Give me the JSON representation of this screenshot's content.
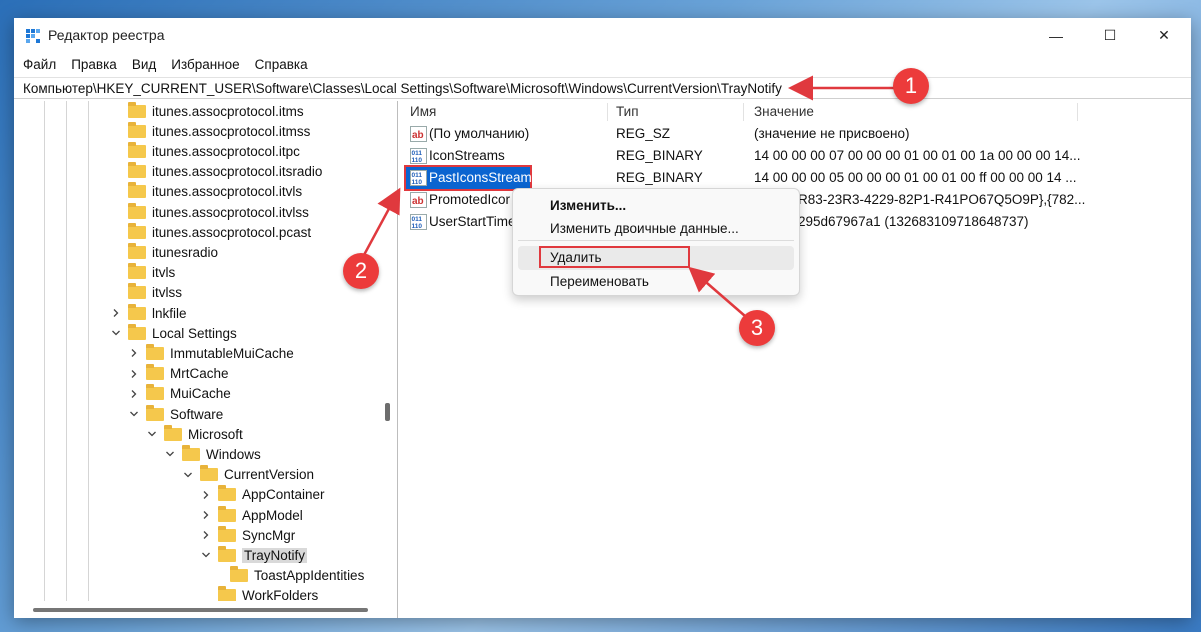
{
  "window": {
    "title": "Редактор реестра",
    "controls": {
      "minimize": "—",
      "maximize": "☐",
      "close": "✕"
    }
  },
  "menu": [
    "Файл",
    "Правка",
    "Вид",
    "Избранное",
    "Справка"
  ],
  "address": "Компьютер\\HKEY_CURRENT_USER\\Software\\Classes\\Local Settings\\Software\\Microsoft\\Windows\\CurrentVersion\\TrayNotify",
  "tree": [
    {
      "label": "itunes.assocprotocol.itms",
      "level": 0,
      "chevron": "none"
    },
    {
      "label": "itunes.assocprotocol.itmss",
      "level": 0,
      "chevron": "none"
    },
    {
      "label": "itunes.assocprotocol.itpc",
      "level": 0,
      "chevron": "none"
    },
    {
      "label": "itunes.assocprotocol.itsradio",
      "level": 0,
      "chevron": "none"
    },
    {
      "label": "itunes.assocprotocol.itvls",
      "level": 0,
      "chevron": "none"
    },
    {
      "label": "itunes.assocprotocol.itvlss",
      "level": 0,
      "chevron": "none"
    },
    {
      "label": "itunes.assocprotocol.pcast",
      "level": 0,
      "chevron": "none"
    },
    {
      "label": "itunesradio",
      "level": 0,
      "chevron": "none"
    },
    {
      "label": "itvls",
      "level": 0,
      "chevron": "none"
    },
    {
      "label": "itvlss",
      "level": 0,
      "chevron": "none"
    },
    {
      "label": "lnkfile",
      "level": 0,
      "chevron": "right"
    },
    {
      "label": "Local Settings",
      "level": 0,
      "chevron": "down"
    },
    {
      "label": "ImmutableMuiCache",
      "level": 1,
      "chevron": "right"
    },
    {
      "label": "MrtCache",
      "level": 1,
      "chevron": "right"
    },
    {
      "label": "MuiCache",
      "level": 1,
      "chevron": "right"
    },
    {
      "label": "Software",
      "level": 1,
      "chevron": "down"
    },
    {
      "label": "Microsoft",
      "level": 2,
      "chevron": "down"
    },
    {
      "label": "Windows",
      "level": 3,
      "chevron": "down"
    },
    {
      "label": "CurrentVersion",
      "level": 4,
      "chevron": "down"
    },
    {
      "label": "AppContainer",
      "level": 5,
      "chevron": "right"
    },
    {
      "label": "AppModel",
      "level": 5,
      "chevron": "right"
    },
    {
      "label": "SyncMgr",
      "level": 5,
      "chevron": "right"
    },
    {
      "label": "TrayNotify",
      "level": 5,
      "chevron": "down",
      "selected": true
    },
    {
      "label": "ToastAppIdentities",
      "level": 6,
      "chevron": "none"
    },
    {
      "label": "WorkFolders",
      "level": 5,
      "chevron": "none"
    }
  ],
  "columns": {
    "name": "Имя",
    "type": "Тип",
    "value": "Значение"
  },
  "values": [
    {
      "name": "(По умолчанию)",
      "type": "REG_SZ",
      "data": "(значение не присвоено)",
      "icon": "string-value-icon"
    },
    {
      "name": "IconStreams",
      "type": "REG_BINARY",
      "data": "14 00 00 00 07 00 00 00 01 00 01 00 1a 00 00 00 14...",
      "icon": "binary-value-icon"
    },
    {
      "name": "PastIconsStream",
      "type": "REG_BINARY",
      "data": "14 00 00 00 05 00 00 00 01 00 01 00 ff 00 00 00 14 ...",
      "icon": "binary-value-icon",
      "selected": true
    },
    {
      "name": "PromotedIcor",
      "type": "",
      "data": "R83-23R3-4229-82P1-R41PO67Q5O9P},{782...",
      "icon": "string-value-icon"
    },
    {
      "name": "UserStartTime",
      "type": "",
      "data": "295d67967a1 (132683109718648737)",
      "icon": "binary-value-icon"
    }
  ],
  "context_menu": {
    "modify": "Изменить...",
    "modify_binary": "Изменить двоичные данные...",
    "delete": "Удалить",
    "rename": "Переименовать"
  },
  "badges": [
    "1",
    "2",
    "3"
  ],
  "colors": {
    "accent": "#0a64d0",
    "annotation": "#e0393e",
    "folder": "#f5c84c"
  }
}
